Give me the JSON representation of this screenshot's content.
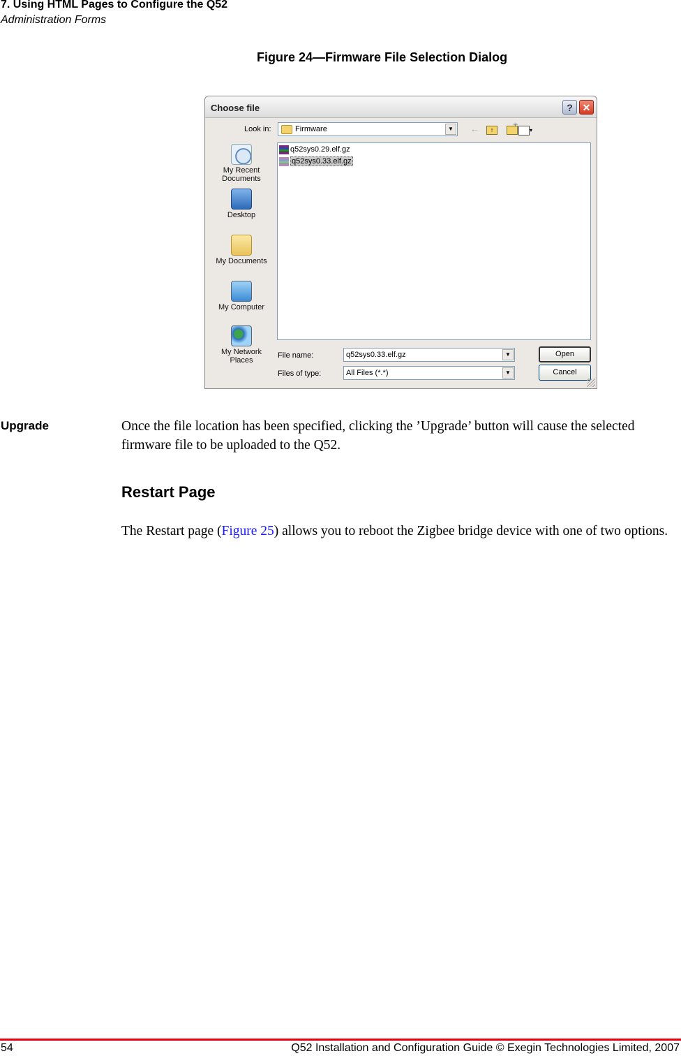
{
  "header": {
    "chapter": "7. Using HTML Pages to Configure the Q52",
    "section": "Administration Forms"
  },
  "figure": {
    "caption": "Figure 24—Firmware File Selection Dialog"
  },
  "dialog": {
    "title": "Choose file",
    "help_icon": "?",
    "close_icon": "✕",
    "look_in_label": "Look in:",
    "look_in_value": "Firmware",
    "toolbar": {
      "back_icon": "←",
      "up_icon": "↑",
      "new_folder_spark": "✳",
      "views_caret": "▾"
    },
    "places": [
      {
        "label_line1": "My Recent",
        "label_line2": "Documents",
        "icon": "recent-documents-icon"
      },
      {
        "label_line1": "Desktop",
        "label_line2": "",
        "icon": "desktop-icon"
      },
      {
        "label_line1": "My Documents",
        "label_line2": "",
        "icon": "my-documents-icon"
      },
      {
        "label_line1": "My Computer",
        "label_line2": "",
        "icon": "my-computer-icon"
      },
      {
        "label_line1": "My Network",
        "label_line2": "Places",
        "icon": "network-places-icon"
      }
    ],
    "files": [
      {
        "name": "q52sys0.29.elf.gz",
        "selected": false
      },
      {
        "name": "q52sys0.33.elf.gz",
        "selected": true
      }
    ],
    "file_name_label": "File name:",
    "file_name_value": "q52sys0.33.elf.gz",
    "file_type_label": "Files of type:",
    "file_type_value": "All Files (*.*)",
    "combo_arrow": "▼",
    "open_label": "Open",
    "cancel_label": "Cancel"
  },
  "body": {
    "term": "Upgrade",
    "term_text": "Once the file location has been specified, clicking the ’Upgrade’ button will cause the selected firmware file to be uploaded to the Q52.",
    "heading": "Restart Page",
    "para_before_link": "The Restart page (",
    "link_text": "Figure 25",
    "para_after_link": ") allows you to reboot the Zigbee bridge device with one of two options."
  },
  "footer": {
    "page_number": "54",
    "text": "Q52 Installation and Configuration Guide  © Exegin Technologies Limited, 2007"
  }
}
